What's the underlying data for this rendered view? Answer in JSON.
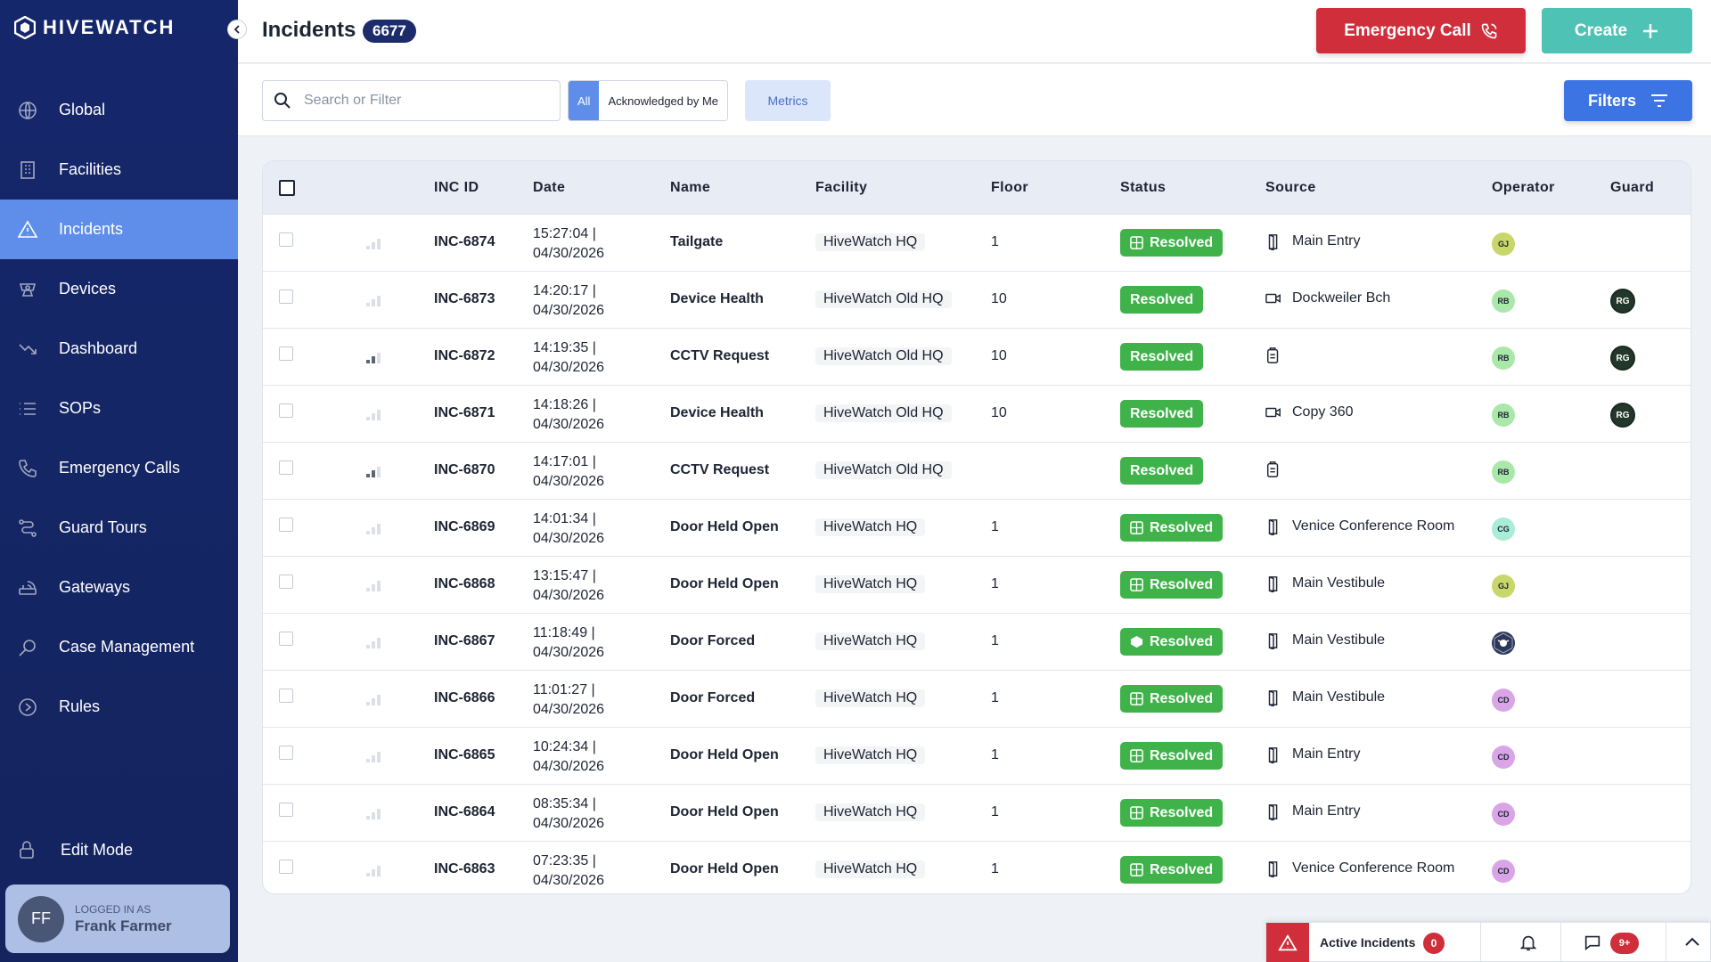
{
  "brand": {
    "name": "HIVEWATCH"
  },
  "sidebar": {
    "items": [
      {
        "label": "Global",
        "icon": "globe-icon"
      },
      {
        "label": "Facilities",
        "icon": "building-icon"
      },
      {
        "label": "Incidents",
        "icon": "warning-icon",
        "active": true
      },
      {
        "label": "Devices",
        "icon": "camera-icon"
      },
      {
        "label": "Dashboard",
        "icon": "trend-icon"
      },
      {
        "label": "SOPs",
        "icon": "list-icon"
      },
      {
        "label": "Emergency Calls",
        "icon": "phone-icon"
      },
      {
        "label": "Guard Tours",
        "icon": "route-icon"
      },
      {
        "label": "Gateways",
        "icon": "router-icon"
      },
      {
        "label": "Case Management",
        "icon": "magnifier-icon"
      },
      {
        "label": "Rules",
        "icon": "play-circle-icon"
      }
    ],
    "edit_mode": "Edit Mode",
    "user": {
      "initials": "FF",
      "logged_in_label": "LOGGED IN AS",
      "name": "Frank Farmer"
    }
  },
  "header": {
    "title": "Incidents",
    "count": "6677",
    "emergency_label": "Emergency Call",
    "create_label": "Create"
  },
  "toolbar": {
    "search_placeholder": "Search or Filter",
    "segment_all": "All",
    "segment_ack": "Acknowledged by Me",
    "metrics_label": "Metrics",
    "filters_label": "Filters"
  },
  "table": {
    "columns": [
      "INC ID",
      "Date",
      "Name",
      "Facility",
      "Floor",
      "Status",
      "Source",
      "Operator",
      "Guard"
    ],
    "rows": [
      {
        "id": "INC-6874",
        "time": "15:27:04 |",
        "date": "04/30/2026",
        "name": "Tailgate",
        "facility": "HiveWatch HQ",
        "floor": "1",
        "status": "Resolved",
        "status_icon": "grid",
        "source_icon": "door",
        "source": "Main Entry",
        "operator": "GJ",
        "guard": "",
        "prio": 0
      },
      {
        "id": "INC-6873",
        "time": "14:20:17 |",
        "date": "04/30/2026",
        "name": "Device Health",
        "facility": "HiveWatch Old HQ",
        "floor": "10",
        "status": "Resolved",
        "status_icon": "",
        "source_icon": "camera",
        "source": "Dockweiler Bch",
        "operator": "RB",
        "guard": "RG",
        "prio": 0
      },
      {
        "id": "INC-6872",
        "time": "14:19:35 |",
        "date": "04/30/2026",
        "name": "CCTV Request",
        "facility": "HiveWatch Old HQ",
        "floor": "10",
        "status": "Resolved",
        "status_icon": "",
        "source_icon": "clipboard",
        "source": "",
        "operator": "RB",
        "guard": "RG",
        "prio": 2
      },
      {
        "id": "INC-6871",
        "time": "14:18:26 |",
        "date": "04/30/2026",
        "name": "Device Health",
        "facility": "HiveWatch Old HQ",
        "floor": "10",
        "status": "Resolved",
        "status_icon": "",
        "source_icon": "camera",
        "source": "Copy 360",
        "operator": "RB",
        "guard": "RG",
        "prio": 0
      },
      {
        "id": "INC-6870",
        "time": "14:17:01 |",
        "date": "04/30/2026",
        "name": "CCTV Request",
        "facility": "HiveWatch Old HQ",
        "floor": "",
        "status": "Resolved",
        "status_icon": "",
        "source_icon": "clipboard",
        "source": "",
        "operator": "RB",
        "guard": "",
        "prio": 2
      },
      {
        "id": "INC-6869",
        "time": "14:01:34 |",
        "date": "04/30/2026",
        "name": "Door Held Open",
        "facility": "HiveWatch HQ",
        "floor": "1",
        "status": "Resolved",
        "status_icon": "grid",
        "source_icon": "door",
        "source": "Venice Conference Room",
        "operator": "CG",
        "guard": "",
        "prio": 0
      },
      {
        "id": "INC-6868",
        "time": "13:15:47 |",
        "date": "04/30/2026",
        "name": "Door Held Open",
        "facility": "HiveWatch HQ",
        "floor": "1",
        "status": "Resolved",
        "status_icon": "grid",
        "source_icon": "door",
        "source": "Main Vestibule",
        "operator": "GJ",
        "guard": "",
        "prio": 0
      },
      {
        "id": "INC-6867",
        "time": "11:18:49 |",
        "date": "04/30/2026",
        "name": "Door Forced",
        "facility": "HiveWatch HQ",
        "floor": "1",
        "status": "Resolved",
        "status_icon": "hex",
        "source_icon": "door",
        "source": "Main Vestibule",
        "operator": "HW",
        "guard": "",
        "prio": 0
      },
      {
        "id": "INC-6866",
        "time": "11:01:27 |",
        "date": "04/30/2026",
        "name": "Door Forced",
        "facility": "HiveWatch HQ",
        "floor": "1",
        "status": "Resolved",
        "status_icon": "grid",
        "source_icon": "door",
        "source": "Main Vestibule",
        "operator": "CD",
        "guard": "",
        "prio": 0
      },
      {
        "id": "INC-6865",
        "time": "10:24:34 |",
        "date": "04/30/2026",
        "name": "Door Held Open",
        "facility": "HiveWatch HQ",
        "floor": "1",
        "status": "Resolved",
        "status_icon": "grid",
        "source_icon": "door",
        "source": "Main Entry",
        "operator": "CD",
        "guard": "",
        "prio": 0
      },
      {
        "id": "INC-6864",
        "time": "08:35:34 |",
        "date": "04/30/2026",
        "name": "Door Held Open",
        "facility": "HiveWatch HQ",
        "floor": "1",
        "status": "Resolved",
        "status_icon": "grid",
        "source_icon": "door",
        "source": "Main Entry",
        "operator": "CD",
        "guard": "",
        "prio": 0
      },
      {
        "id": "INC-6863",
        "time": "07:23:35 |",
        "date": "04/30/2026",
        "name": "Door Held Open",
        "facility": "HiveWatch HQ",
        "floor": "1",
        "status": "Resolved",
        "status_icon": "grid",
        "source_icon": "door",
        "source": "Venice Conference Room",
        "operator": "CD",
        "guard": "",
        "prio": 0
      }
    ]
  },
  "operator_colors": {
    "GJ": "#c8d66a",
    "RB": "#a9e8a9",
    "CG": "#a9ecd8",
    "CD": "#d9a5e6"
  },
  "bottom_bar": {
    "active_label": "Active Incidents",
    "active_count": "0",
    "messages_count": "9+"
  },
  "colors": {
    "accent": "#5e8eea",
    "sidebar": "#15276b",
    "resolved": "#3fb24a",
    "danger": "#cf2e3a",
    "create": "#4ec2b4"
  }
}
